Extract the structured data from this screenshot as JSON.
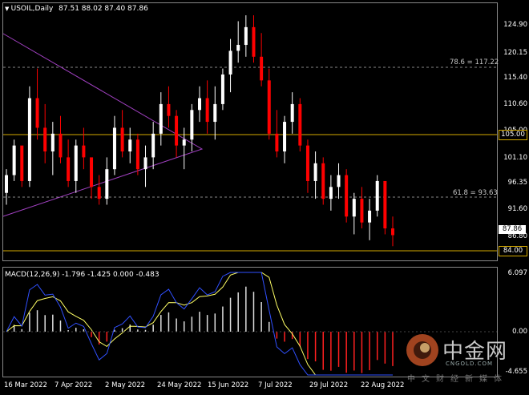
{
  "window": {
    "symbol_title": "USOIL,Daily",
    "ohlc": "87.51 88.02 87.40 87.86"
  },
  "price_axis": {
    "ticks": [
      "124.90",
      "120.15",
      "115.40",
      "110.60",
      "105.00",
      "101.10",
      "96.35",
      "91.60",
      "86.80"
    ],
    "current_price": "87.86",
    "hline_upper": "105.00",
    "hline_lower": "84.00"
  },
  "fib_levels": {
    "level_78": "78.6 = 117.22",
    "level_61": "61.8 = 93.63"
  },
  "macd": {
    "title": "MACD(12,26,9) -1.796 -1.425 0.000 -0.483",
    "axis_top": "6.097",
    "axis_zero": "0.00",
    "axis_bottom": "-4.655"
  },
  "time_axis": [
    "16 Mar 2022",
    "7 Apr 2022",
    "2 May 2022",
    "24 May 2022",
    "15 Jun 2022",
    "7 Jul 2022",
    "29 Jul 2022",
    "22 Aug 2022"
  ],
  "watermark": {
    "brand": "中金网",
    "domain": "CNGOLD.COM",
    "tagline": "中文财经新媒体"
  },
  "colors": {
    "bull": "#ffffff",
    "bear": "#ff0000",
    "hline": "#d4aa00",
    "triangle": "#a040c0",
    "macd_signal": "#ffff66",
    "macd_main": "#3050ff"
  },
  "chart_data": {
    "type": "candlestick",
    "price_range": [
      84.0,
      126.5
    ],
    "candles": [
      [
        95,
        99,
        93,
        98
      ],
      [
        98,
        104,
        97,
        103
      ],
      [
        103,
        101,
        96,
        97
      ],
      [
        97,
        113,
        96,
        111
      ],
      [
        111,
        116,
        104,
        106
      ],
      [
        106,
        110,
        100,
        102
      ],
      [
        102,
        107,
        98,
        105
      ],
      [
        105,
        108,
        100,
        101
      ],
      [
        101,
        104,
        96,
        97
      ],
      [
        97,
        104,
        95,
        103
      ],
      [
        103,
        106,
        99,
        101
      ],
      [
        101,
        100,
        94,
        96
      ],
      [
        96,
        98,
        93,
        94
      ],
      [
        94,
        101,
        93,
        99
      ],
      [
        99,
        108,
        98,
        106
      ],
      [
        106,
        109,
        101,
        102
      ],
      [
        102,
        106,
        100,
        104
      ],
      [
        104,
        105,
        98,
        99
      ],
      [
        99,
        103,
        96,
        101
      ],
      [
        101,
        107,
        99,
        105
      ],
      [
        105,
        112,
        103,
        110
      ],
      [
        110,
        113,
        106,
        108
      ],
      [
        108,
        109,
        101,
        103
      ],
      [
        103,
        106,
        99,
        104
      ],
      [
        104,
        110,
        102,
        109
      ],
      [
        109,
        113,
        107,
        111
      ],
      [
        111,
        114,
        105,
        107
      ],
      [
        107,
        113,
        104,
        110
      ],
      [
        110,
        116,
        109,
        115
      ],
      [
        115,
        121,
        112,
        119
      ],
      [
        119,
        124,
        117,
        120
      ],
      [
        120,
        125,
        118,
        123
      ],
      [
        123,
        125,
        117,
        118
      ],
      [
        118,
        122,
        113,
        114
      ],
      [
        114,
        116,
        104,
        105
      ],
      [
        105,
        109,
        101,
        102
      ],
      [
        102,
        108,
        100,
        107
      ],
      [
        107,
        112,
        105,
        110
      ],
      [
        110,
        111,
        102,
        103
      ],
      [
        103,
        104,
        95,
        97
      ],
      [
        97,
        102,
        94,
        100
      ],
      [
        100,
        101,
        93,
        94
      ],
      [
        94,
        98,
        92,
        96
      ],
      [
        96,
        100,
        94,
        98
      ],
      [
        98,
        99,
        90,
        91
      ],
      [
        91,
        95,
        88,
        94
      ],
      [
        94,
        96,
        89,
        90
      ],
      [
        90,
        94,
        87,
        92
      ],
      [
        92,
        98,
        91,
        97
      ],
      [
        97,
        96,
        88,
        89
      ],
      [
        89,
        91,
        86,
        87.86
      ]
    ]
  }
}
